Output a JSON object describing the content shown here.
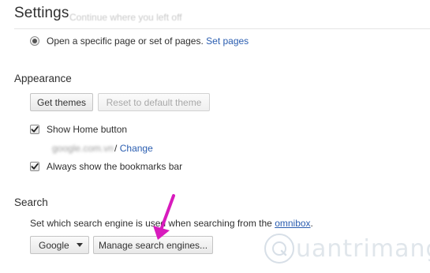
{
  "page": {
    "title": "Settings",
    "ghost_text": "Continue where you left off"
  },
  "startup": {
    "option_label": "Open a specific page or set of pages.",
    "link_label": "Set pages",
    "selected": true
  },
  "appearance": {
    "heading": "Appearance",
    "get_themes_label": "Get themes",
    "reset_theme_label": "Reset to default theme",
    "show_home_button": {
      "label": "Show Home button",
      "checked": true
    },
    "home_url": "google.com.vn",
    "home_url_suffix": "/",
    "change_link": "Change",
    "bookmarks_bar": {
      "label": "Always show the bookmarks bar",
      "checked": true
    }
  },
  "search": {
    "heading": "Search",
    "description_prefix": "Set which search engine is used when searching from the",
    "omnibox_link": "omnibox",
    "description_suffix": ".",
    "engine_selected": "Google",
    "manage_button_label": "Manage search engines..."
  },
  "annotation": {
    "arrow_color": "#d81bbd"
  },
  "watermark": {
    "text": "uantrimang"
  },
  "colors": {
    "link": "#2a5db0",
    "text": "#303030",
    "disabled_text": "#a8a8a8"
  }
}
